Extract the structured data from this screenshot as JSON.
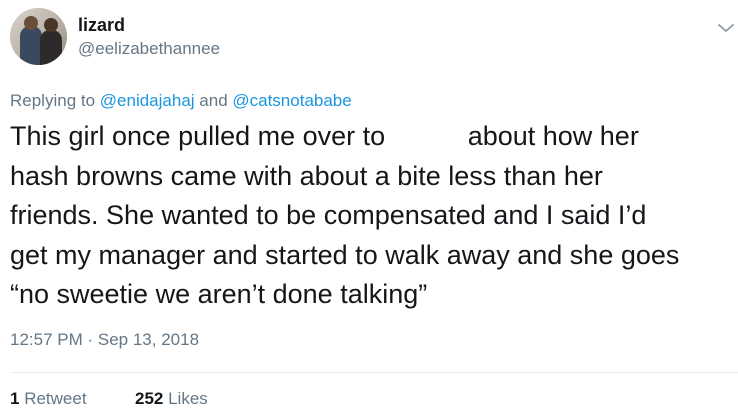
{
  "user": {
    "name": "lizard",
    "handle": "@eelizabethannee"
  },
  "reply": {
    "prefix": "Replying to ",
    "mention1": "@enidajahaj",
    "conjunction": " and ",
    "mention2": "@catsnotababe"
  },
  "tweet": {
    "lines": [
      "This girl once pulled me over to           about how her",
      "hash browns came with about a bite less than her",
      "friends. She wanted to be compensated and I said I’d",
      "get my manager and started to walk away and she goes",
      "“no sweetie we aren’t done talking”"
    ]
  },
  "meta": {
    "time": "12:57 PM",
    "separator": " · ",
    "date": "Sep 13, 2018"
  },
  "stats": {
    "retweet_count": "1",
    "retweet_label": " Retweet",
    "likes_count": "252",
    "likes_label": " Likes"
  },
  "icons": {
    "menu": "chevron-down-icon"
  },
  "colors": {
    "link": "#1b95e0",
    "secondary_text": "#657786",
    "primary_text": "#14171a"
  }
}
